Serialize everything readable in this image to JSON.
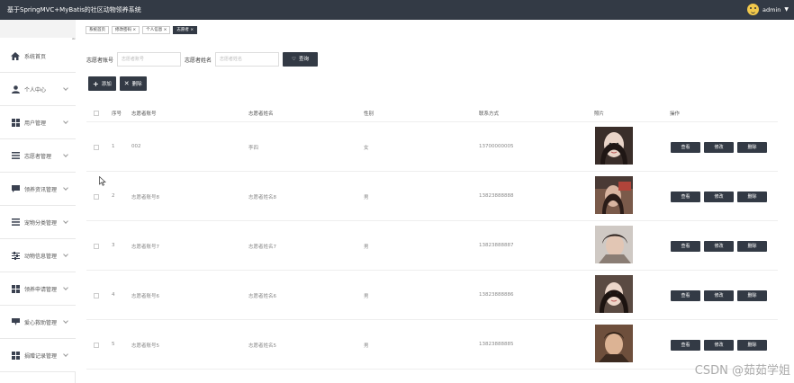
{
  "header": {
    "title": "基于SpringMVC+MyBatis的社区动物领养系统",
    "user": "admin"
  },
  "sidebar": {
    "items": [
      {
        "label": "系统首页",
        "icon": "home-icon"
      },
      {
        "label": "个人中心",
        "icon": "user-icon"
      },
      {
        "label": "用户管理",
        "icon": "grid-icon"
      },
      {
        "label": "志愿者管理",
        "icon": "list-icon"
      },
      {
        "label": "领养资讯管理",
        "icon": "chat-icon"
      },
      {
        "label": "宠物分类管理",
        "icon": "list-icon"
      },
      {
        "label": "动物信息管理",
        "icon": "sliders-icon"
      },
      {
        "label": "领养申请管理",
        "icon": "grid-icon"
      },
      {
        "label": "爱心救助管理",
        "icon": "comment-icon"
      },
      {
        "label": "捐赠记录管理",
        "icon": "grid-icon"
      }
    ]
  },
  "tabs": [
    "系统首页",
    "修改密码 ×",
    "个人信息 ×",
    "志愿者 ×"
  ],
  "search": {
    "account_label": "志愿者账号",
    "account_placeholder": "志愿者账号",
    "name_label": "志愿者姓名",
    "name_placeholder": "志愿者姓名",
    "query_label": "查询"
  },
  "toolbar": {
    "add_label": "添加",
    "delete_label": "删除"
  },
  "table": {
    "columns": [
      "序号",
      "志愿者账号",
      "志愿者姓名",
      "性别",
      "联系方式",
      "照片",
      "操作"
    ],
    "rows": [
      {
        "index": "1",
        "account": "002",
        "name": "李四",
        "gender": "女",
        "phone": "13700000005"
      },
      {
        "index": "2",
        "account": "志愿者账号8",
        "name": "志愿者姓名8",
        "gender": "男",
        "phone": "13823888888"
      },
      {
        "index": "3",
        "account": "志愿者账号7",
        "name": "志愿者姓名7",
        "gender": "男",
        "phone": "13823888887"
      },
      {
        "index": "4",
        "account": "志愿者账号6",
        "name": "志愿者姓名6",
        "gender": "男",
        "phone": "13823888886"
      },
      {
        "index": "5",
        "account": "志愿者账号5",
        "name": "志愿者姓名5",
        "gender": "男",
        "phone": "13823888885"
      }
    ],
    "row_actions": {
      "view": "查看",
      "edit": "修改",
      "delete": "删除"
    }
  },
  "watermark": "CSDN @茹茹学姐",
  "colors": {
    "header_bg": "#333a45",
    "button_bg": "#333a45",
    "active_tab_bg": "#333a45"
  }
}
